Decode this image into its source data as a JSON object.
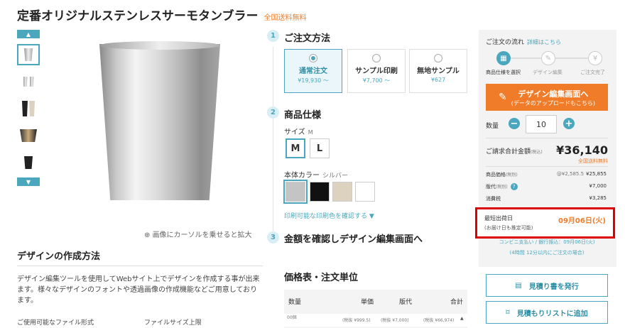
{
  "product": {
    "title": "定番オリジナルステンレスサーモタンブラー",
    "shipping_badge": "全国送料無料"
  },
  "gallery": {
    "zoom_hint": "画像にカーソルを乗せると拡大"
  },
  "design_section": {
    "heading": "デザインの作成方法",
    "description": "デザイン編集ツールを使用してWebサイト上でデザインを作成する事が出来ます。様々なデザインのフォントや透過画像の作成機能などご用意しております。",
    "file_format_label": "ご使用可能なファイル形式",
    "file_size_label": "ファイルサイズ上限"
  },
  "order_method": {
    "step": "1",
    "title": "ご注文方法",
    "options": [
      {
        "label": "通常注文",
        "price": "¥19,930 〜",
        "selected": true
      },
      {
        "label": "サンプル印刷",
        "price": "¥7,700 〜",
        "selected": false
      },
      {
        "label": "無地サンプル",
        "price": "¥627",
        "selected": false
      }
    ]
  },
  "spec": {
    "step": "2",
    "title": "商品仕様",
    "size_label": "サイズ",
    "size_value": "M",
    "sizes": [
      "M",
      "L"
    ],
    "color_label": "本体カラー",
    "color_value": "シルバー",
    "colors": [
      "#c4c4c4",
      "#111111",
      "#ddd2bf",
      "#ffffff"
    ],
    "print_color_link": "印刷可能な印刷色を確認する ▼"
  },
  "confirm": {
    "step": "3",
    "title": "金額を確認しデザイン編集画面へ"
  },
  "price_table": {
    "heading": "価格表・注文単位",
    "headers": [
      "数量",
      "単価",
      "版代",
      "合計"
    ],
    "row": {
      "qty": "00個",
      "unit": "(税抜 ¥999.5)",
      "plate": "(税抜 ¥7,000)",
      "total": "(税抜 ¥66,974)"
    }
  },
  "order_panel": {
    "flow_title": "ご注文の流れ",
    "flow_link": "詳細はこちら",
    "flow_steps": [
      "商品仕様を選択",
      "デザイン編集",
      "ご注文完了"
    ],
    "design_button_line1": "デザイン編集画面へ",
    "design_button_line2": "(データのアップロードもこちら)",
    "qty_label": "数量",
    "qty_value": "10",
    "total_label": "ご請求合計金額",
    "total_tax_note": "(税込)",
    "total_value": "¥36,140",
    "total_shipping": "全国送料無料",
    "breakdown": [
      {
        "label": "商品価格",
        "tag": "(税別)",
        "note": "@¥2,585.5",
        "value": "¥25,855"
      },
      {
        "label": "版代",
        "tag": "(税別)",
        "note": "",
        "value": "¥7,000"
      },
      {
        "label": "消費税",
        "tag": "",
        "note": "",
        "value": "¥3,285"
      }
    ],
    "ship_label": "最短出荷日",
    "ship_note": "(お届け日も推定可能)",
    "ship_date": "09月06日(火)",
    "payment_note": "コンビニ支払い / 銀行振込：09月06日(火)",
    "payment_note2": "(4時間 12分以内にご注文の場合)",
    "quote_button": "見積り書を発行",
    "quote_list_button": "見積もりリストに追加"
  }
}
